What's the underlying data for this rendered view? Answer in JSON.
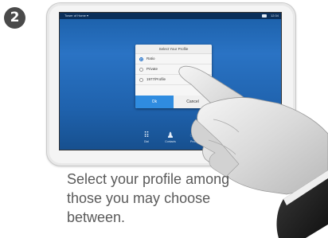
{
  "step_number": "2",
  "statusbar": {
    "title": "Tower of Home ▾",
    "time": "12:34"
  },
  "dialog": {
    "title": "Select Your Profile",
    "options": [
      {
        "label": "Ratio",
        "selected": true
      },
      {
        "label": "Private",
        "selected": false
      },
      {
        "label": "1977/Profile",
        "selected": false
      }
    ],
    "ok_label": "Ok",
    "cancel_label": "Cancel"
  },
  "toolbar": {
    "items": [
      {
        "label": "Dial",
        "icon": "keypad-icon"
      },
      {
        "label": "Contacts",
        "icon": "person-icon"
      },
      {
        "label": "Profile",
        "icon": "profile-icon"
      }
    ]
  },
  "caption": {
    "line1": "Select your profile among",
    "line2": "those you may choose",
    "line3": "between."
  }
}
